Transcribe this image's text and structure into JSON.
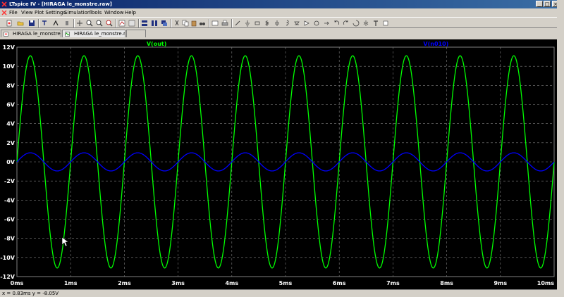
{
  "window": {
    "title": "LTspice IV - [HIRAGA le_monstre.raw]",
    "buttons": {
      "minimize": "_",
      "maximize": "□",
      "close": "×"
    }
  },
  "menu": [
    "File",
    "View",
    "Plot Settings",
    "Simulation",
    "Tools",
    "Window",
    "Help"
  ],
  "tabs": [
    {
      "label": "HIRAGA le_monstre.asc",
      "active": false
    },
    {
      "label": "HIRAGA le_monstre.raw",
      "active": true
    }
  ],
  "status": {
    "text": "x = 0.83ms   y = -8.05V"
  },
  "chart_data": {
    "type": "line",
    "xlim": [
      0,
      10
    ],
    "ylim": [
      -12,
      12
    ],
    "x_ticks": [
      "0ms",
      "1ms",
      "2ms",
      "3ms",
      "4ms",
      "5ms",
      "6ms",
      "7ms",
      "8ms",
      "9ms",
      "10ms"
    ],
    "y_ticks": [
      "12V",
      "10V",
      "8V",
      "6V",
      "4V",
      "2V",
      "0V",
      "-2V",
      "-4V",
      "-6V",
      "-8V",
      "-10V",
      "-12V"
    ],
    "grid": true,
    "series": [
      {
        "name": "V(out)",
        "color": "#00ff00",
        "frequency_khz": 1,
        "amplitude_v": 11.1,
        "offset_v": 0,
        "phase_deg": 0
      },
      {
        "name": "V(n010)",
        "color": "#0000ff",
        "frequency_khz": 1,
        "amplitude_v": 0.95,
        "offset_v": 0,
        "phase_deg": 0
      }
    ]
  }
}
